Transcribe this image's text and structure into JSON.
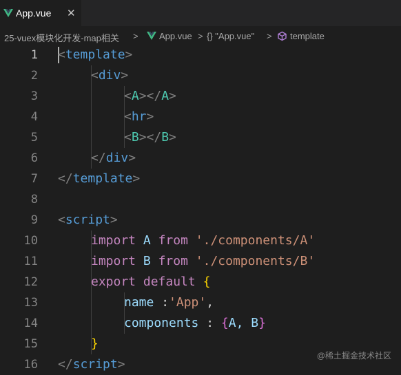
{
  "tab": {
    "title": "App.vue",
    "close": "✕",
    "icon": "vue-icon"
  },
  "breadcrumb": {
    "folder": "25-vuex模块化开发-map相关",
    "sep": ">",
    "file": "App.vue",
    "object": "{} \"App.vue\"",
    "node": "template"
  },
  "line_numbers": [
    "1",
    "2",
    "3",
    "4",
    "5",
    "6",
    "7",
    "8",
    "9",
    "10",
    "11",
    "12",
    "13",
    "14",
    "15",
    "16"
  ],
  "code": {
    "l1": [
      "<",
      "template",
      ">"
    ],
    "l2": [
      "<",
      "div",
      ">"
    ],
    "l3": [
      "<",
      "A",
      "></",
      "A",
      ">"
    ],
    "l4": [
      "<",
      "hr",
      ">"
    ],
    "l5": [
      "<",
      "B",
      "></",
      "B",
      ">"
    ],
    "l6": [
      "</",
      "div",
      ">"
    ],
    "l7": [
      "</",
      "template",
      ">"
    ],
    "l9": [
      "<",
      "script",
      ">"
    ],
    "l10": [
      "import",
      " ",
      "A",
      " ",
      "from",
      " ",
      "'./components/A'"
    ],
    "l11": [
      "import",
      " ",
      "B",
      " ",
      "from",
      " ",
      "'./components/B'"
    ],
    "l12": [
      "export",
      " ",
      "default",
      " ",
      "{"
    ],
    "l13": [
      "name",
      " :",
      "'App'",
      ","
    ],
    "l14": [
      "components",
      " : ",
      "{",
      "A, B",
      "}"
    ],
    "l15": [
      "}"
    ],
    "l16": [
      "</",
      "script",
      ">"
    ]
  },
  "watermark": "@稀土掘金技术社区",
  "colors": {
    "keyword": "#c586c0",
    "tag": "#569cd6",
    "component": "#4ec9b0",
    "string": "#ce9178",
    "variable": "#9cdcfe",
    "brace": "#ffd700"
  }
}
